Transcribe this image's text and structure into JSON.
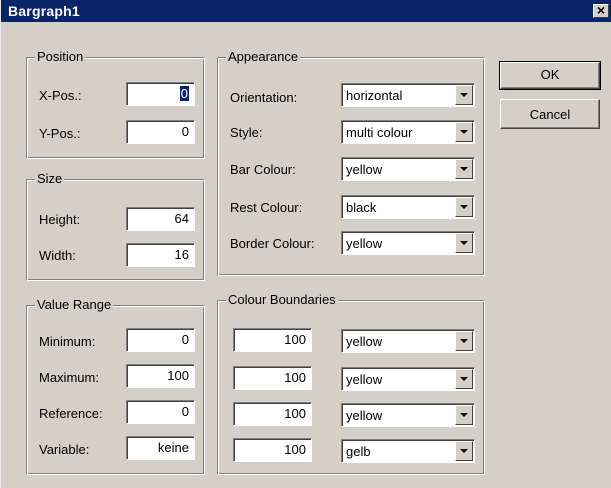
{
  "window": {
    "title": "Bargraph1",
    "close_glyph": "×"
  },
  "position": {
    "title": "Position",
    "xpos_label": "X-Pos.:",
    "xpos_value": "0",
    "ypos_label": "Y-Pos.:",
    "ypos_value": "0"
  },
  "size": {
    "title": "Size",
    "height_label": "Height:",
    "height_value": "64",
    "width_label": "Width:",
    "width_value": "16"
  },
  "value_range": {
    "title": "Value Range",
    "minimum_label": "Minimum:",
    "minimum_value": "0",
    "maximum_label": "Maximum:",
    "maximum_value": "100",
    "reference_label": "Reference:",
    "reference_value": "0",
    "variable_label": "Variable:",
    "variable_value": "keine"
  },
  "appearance": {
    "title": "Appearance",
    "orientation_label": "Orientation:",
    "orientation_value": "horizontal",
    "style_label": "Style:",
    "style_value": "multi colour",
    "bar_colour_label": "Bar Colour:",
    "bar_colour_value": "yellow",
    "rest_colour_label": "Rest Colour:",
    "rest_colour_value": "black",
    "border_colour_label": "Border Colour:",
    "border_colour_value": "yellow"
  },
  "colour_boundaries": {
    "title": "Colour Boundaries",
    "rows": [
      {
        "value": "100",
        "colour": "yellow"
      },
      {
        "value": "100",
        "colour": "yellow"
      },
      {
        "value": "100",
        "colour": "yellow"
      },
      {
        "value": "100",
        "colour": "gelb"
      }
    ]
  },
  "buttons": {
    "ok": "OK",
    "cancel": "Cancel"
  }
}
